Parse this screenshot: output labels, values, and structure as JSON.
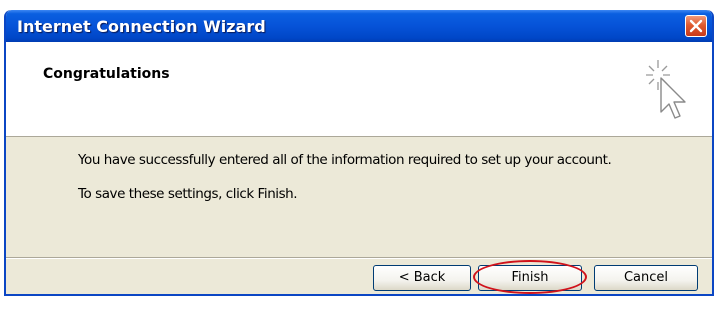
{
  "window": {
    "title": "Internet Connection Wizard",
    "close_icon": "close-x-icon"
  },
  "header": {
    "title": "Congratulations",
    "icon": "wizard-cursor-sparkle-icon"
  },
  "content": {
    "line1": "You have successfully entered all of the information required to set up your account.",
    "line2": "To save these settings, click Finish."
  },
  "buttons": {
    "back": "< Back",
    "finish": "Finish",
    "cancel": "Cancel"
  },
  "annotation": {
    "highlight_color": "#d0121b",
    "highlighted_button": "Finish"
  },
  "colors": {
    "titlebar": "#0653d8",
    "dialog_bg": "#ece9d8",
    "close_button": "#e05a2f"
  }
}
